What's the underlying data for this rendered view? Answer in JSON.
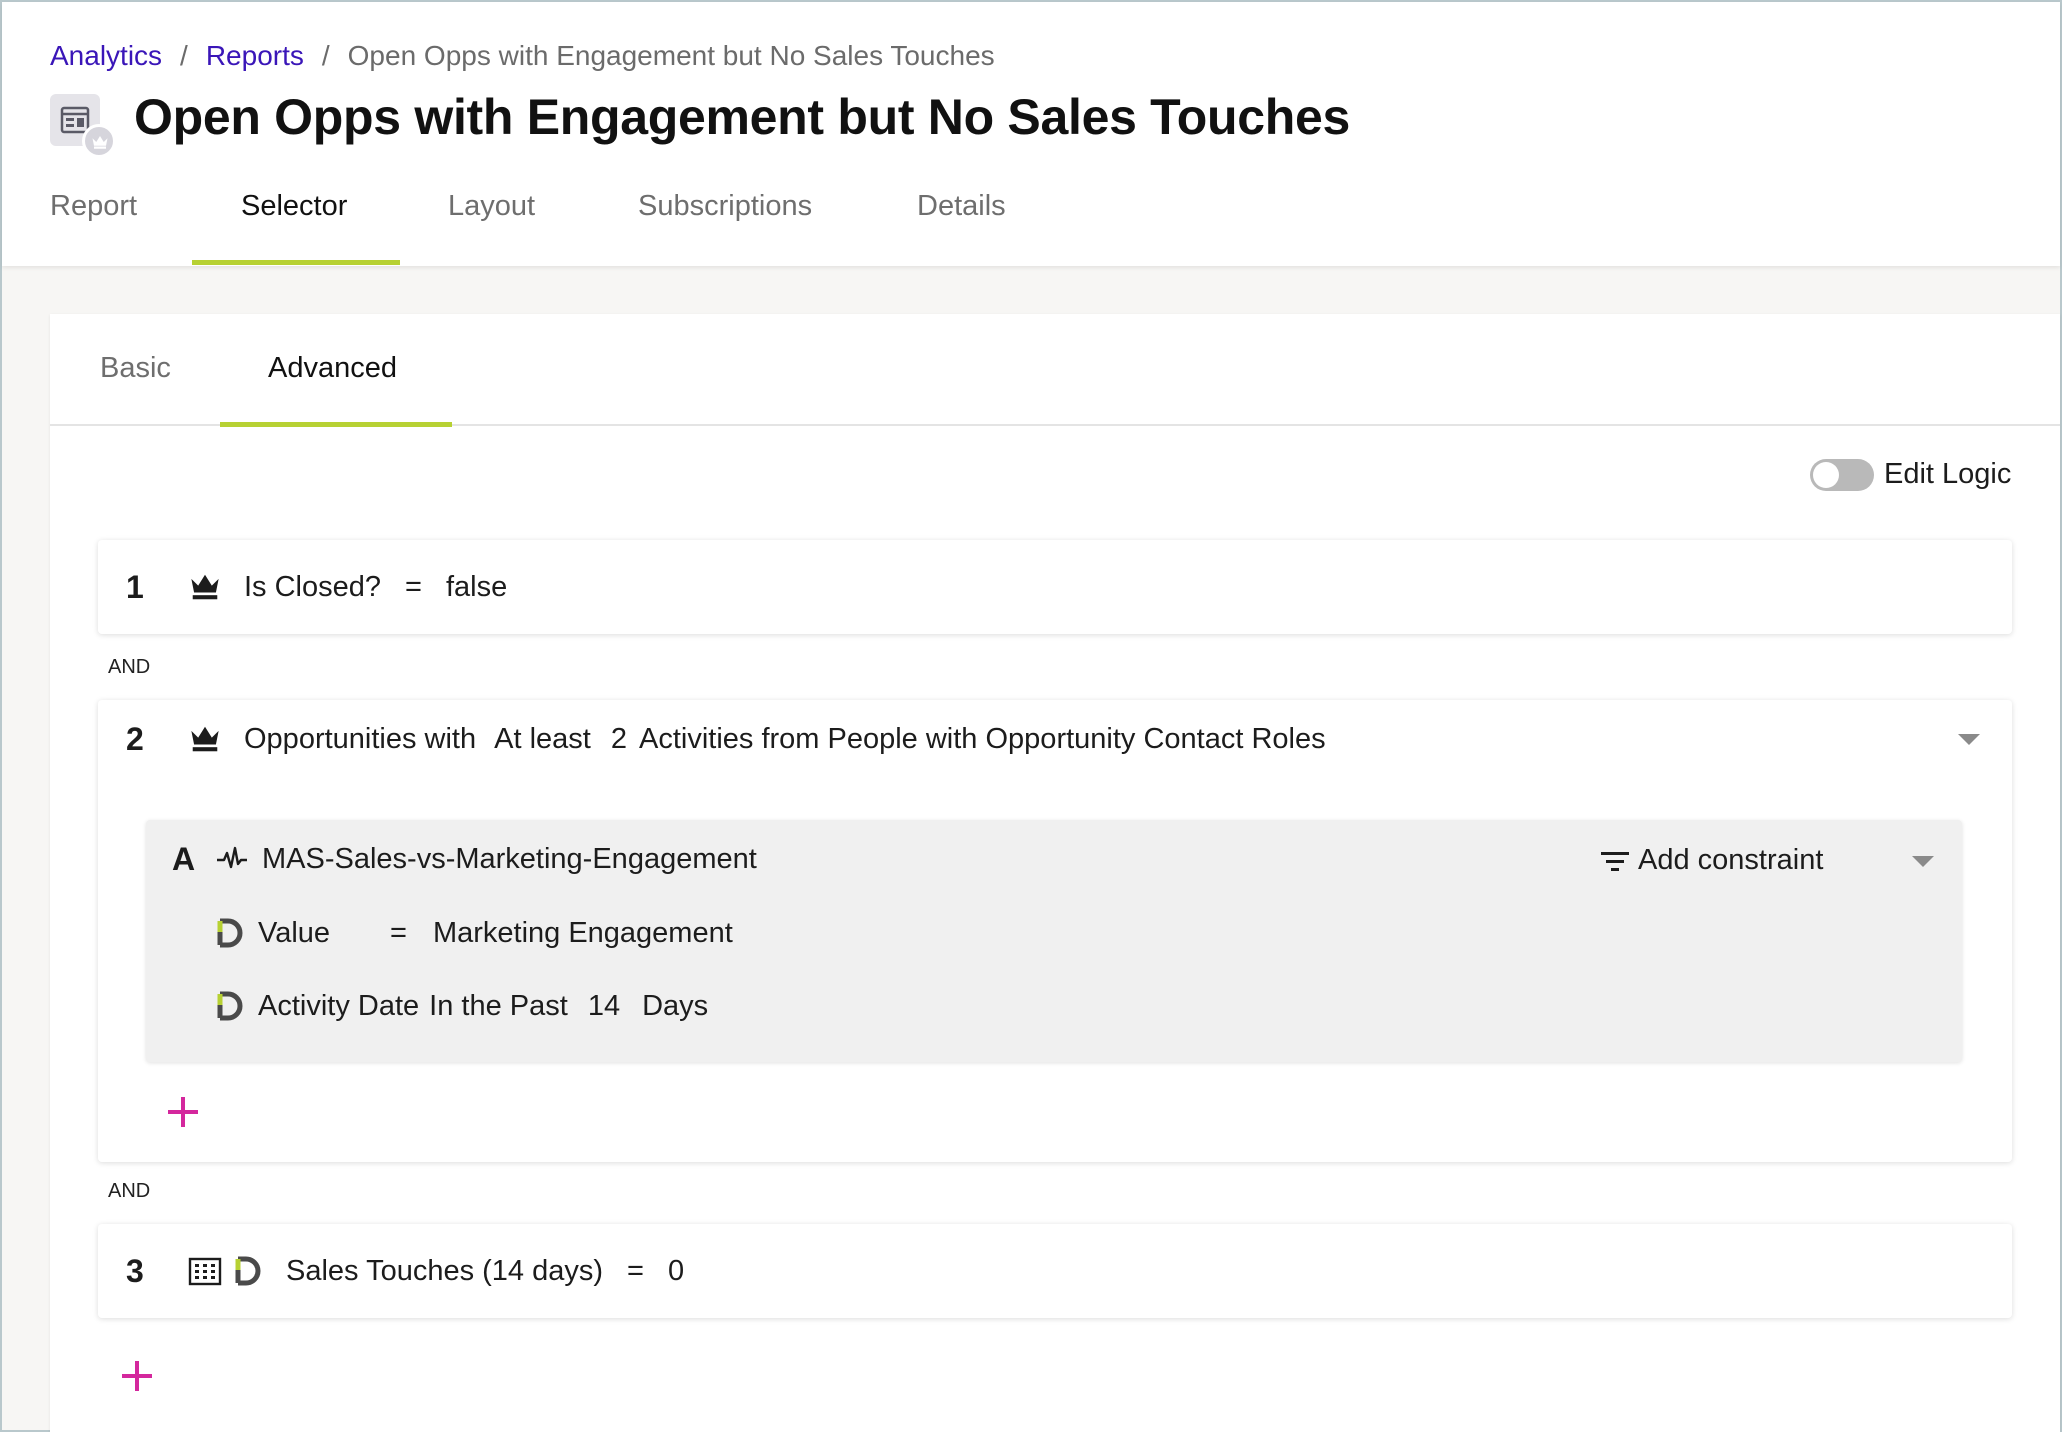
{
  "breadcrumb": {
    "items": [
      "Analytics",
      "Reports"
    ],
    "separator": "/",
    "current": "Open Opps with Engagement but No Sales Touches"
  },
  "page": {
    "title": "Open Opps with Engagement but No Sales Touches"
  },
  "top_tabs": [
    "Report",
    "Selector",
    "Layout",
    "Subscriptions",
    "Details"
  ],
  "top_tabs_active": "Selector",
  "sub_tabs": [
    "Basic",
    "Advanced"
  ],
  "sub_tabs_active": "Advanced",
  "edit_logic": {
    "label": "Edit Logic",
    "enabled": false
  },
  "rules": [
    {
      "number": "1",
      "field": "Is Closed?",
      "operator": "=",
      "value": "false"
    },
    {
      "number": "2",
      "prefix": "Opportunities with",
      "quantifier": "At least",
      "count": "2",
      "description": "Activities from People with Opportunity Contact Roles",
      "sub": {
        "letter": "A",
        "name": "MAS-Sales-vs-Marketing-Engagement",
        "add_constraint": "Add constraint",
        "constraints": [
          {
            "field": "Value",
            "operator": "=",
            "value": "Marketing Engagement"
          },
          {
            "field": "Activity Date",
            "operator": "In the Past",
            "value": "14",
            "unit": "Days"
          }
        ]
      }
    },
    {
      "number": "3",
      "field": "Sales Touches (14 days)",
      "operator": "=",
      "value": "0"
    }
  ],
  "connectors": [
    "AND",
    "AND"
  ],
  "colors": {
    "link": "#3a16b8",
    "accent": "#b7d133",
    "add": "#d4279d"
  },
  "icons": {
    "crown": "crown-icon",
    "activity": "activity-pulse-icon",
    "data_source": "d-logo-icon",
    "building": "building-icon",
    "filter": "filter-icon",
    "add": "plus-icon"
  }
}
